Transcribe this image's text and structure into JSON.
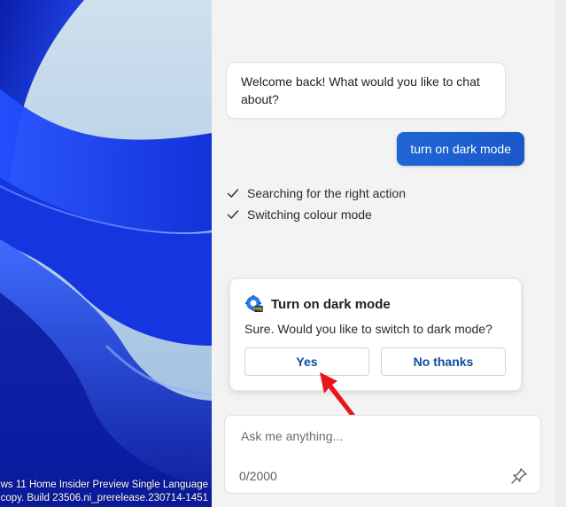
{
  "desktop": {
    "watermark_line1": "ws 11 Home Insider Preview Single Language",
    "watermark_line2": "copy. Build 23506.ni_prerelease.230714-1451"
  },
  "chat": {
    "bot_message": "Welcome back! What would you like to chat about?",
    "user_message": "turn on dark mode",
    "steps": [
      {
        "label": "Searching for the right action",
        "icon": "check-icon"
      },
      {
        "label": "Switching colour mode",
        "icon": "check-icon"
      }
    ]
  },
  "action_card": {
    "icon": "settings-icon",
    "title": "Turn on dark mode",
    "body": "Sure. Would you like to switch to dark mode?",
    "yes_label": "Yes",
    "no_label": "No thanks"
  },
  "input": {
    "placeholder": "Ask me anything...",
    "value": "",
    "char_count": "0/2000",
    "pin_icon": "pin-icon"
  },
  "colors": {
    "accent": "#1f66d6",
    "button_text": "#0f4c9e",
    "cursor_arrow": "#e8161b"
  }
}
